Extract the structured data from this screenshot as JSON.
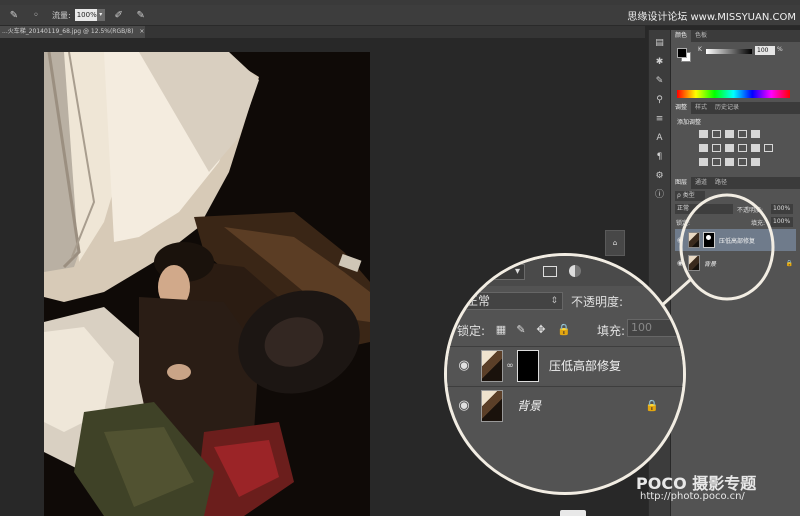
{
  "options_bar": {
    "flow_label": "流量:",
    "flow_value": "100%"
  },
  "watermark_top": "思缘设计论坛 www.MISSYUAN.COM",
  "document": {
    "tab_title": "...火车梯_20140119_68.jpg @ 12.5%(RGB/8)",
    "close": "×"
  },
  "color_panel": {
    "tabs": [
      "颜色",
      "色板"
    ],
    "channel_label": "K",
    "channel_value": "100",
    "channel_unit": "%"
  },
  "adjustments_panel": {
    "tabs": [
      "调整",
      "样式",
      "历史记录"
    ],
    "title": "添加调整"
  },
  "layers_panel": {
    "tabs": [
      "图层",
      "通道",
      "路径"
    ],
    "search_label": "ρ 类型",
    "blend_mode": "正常",
    "opacity_label": "不透明度:",
    "opacity_value": "100%",
    "lock_label": "锁定:",
    "fill_label": "填充:",
    "fill_value": "100%",
    "layers": [
      {
        "name": "压低高部修复",
        "selected": true,
        "has_mask": true
      },
      {
        "name": "背景",
        "selected": false,
        "has_mask": false,
        "locked": true
      }
    ]
  },
  "zoom_callout": {
    "blend_mode": "正常",
    "opacity_label": "不透明度:",
    "lock_label": "锁定:",
    "fill_label": "填充:",
    "fill_value": "100",
    "layers": [
      {
        "name": "压低高部修复"
      },
      {
        "name": "背景"
      }
    ]
  },
  "footer": {
    "poco_brand": "POCO 摄影专题",
    "poco_url": "http://photo.poco.cn/"
  }
}
